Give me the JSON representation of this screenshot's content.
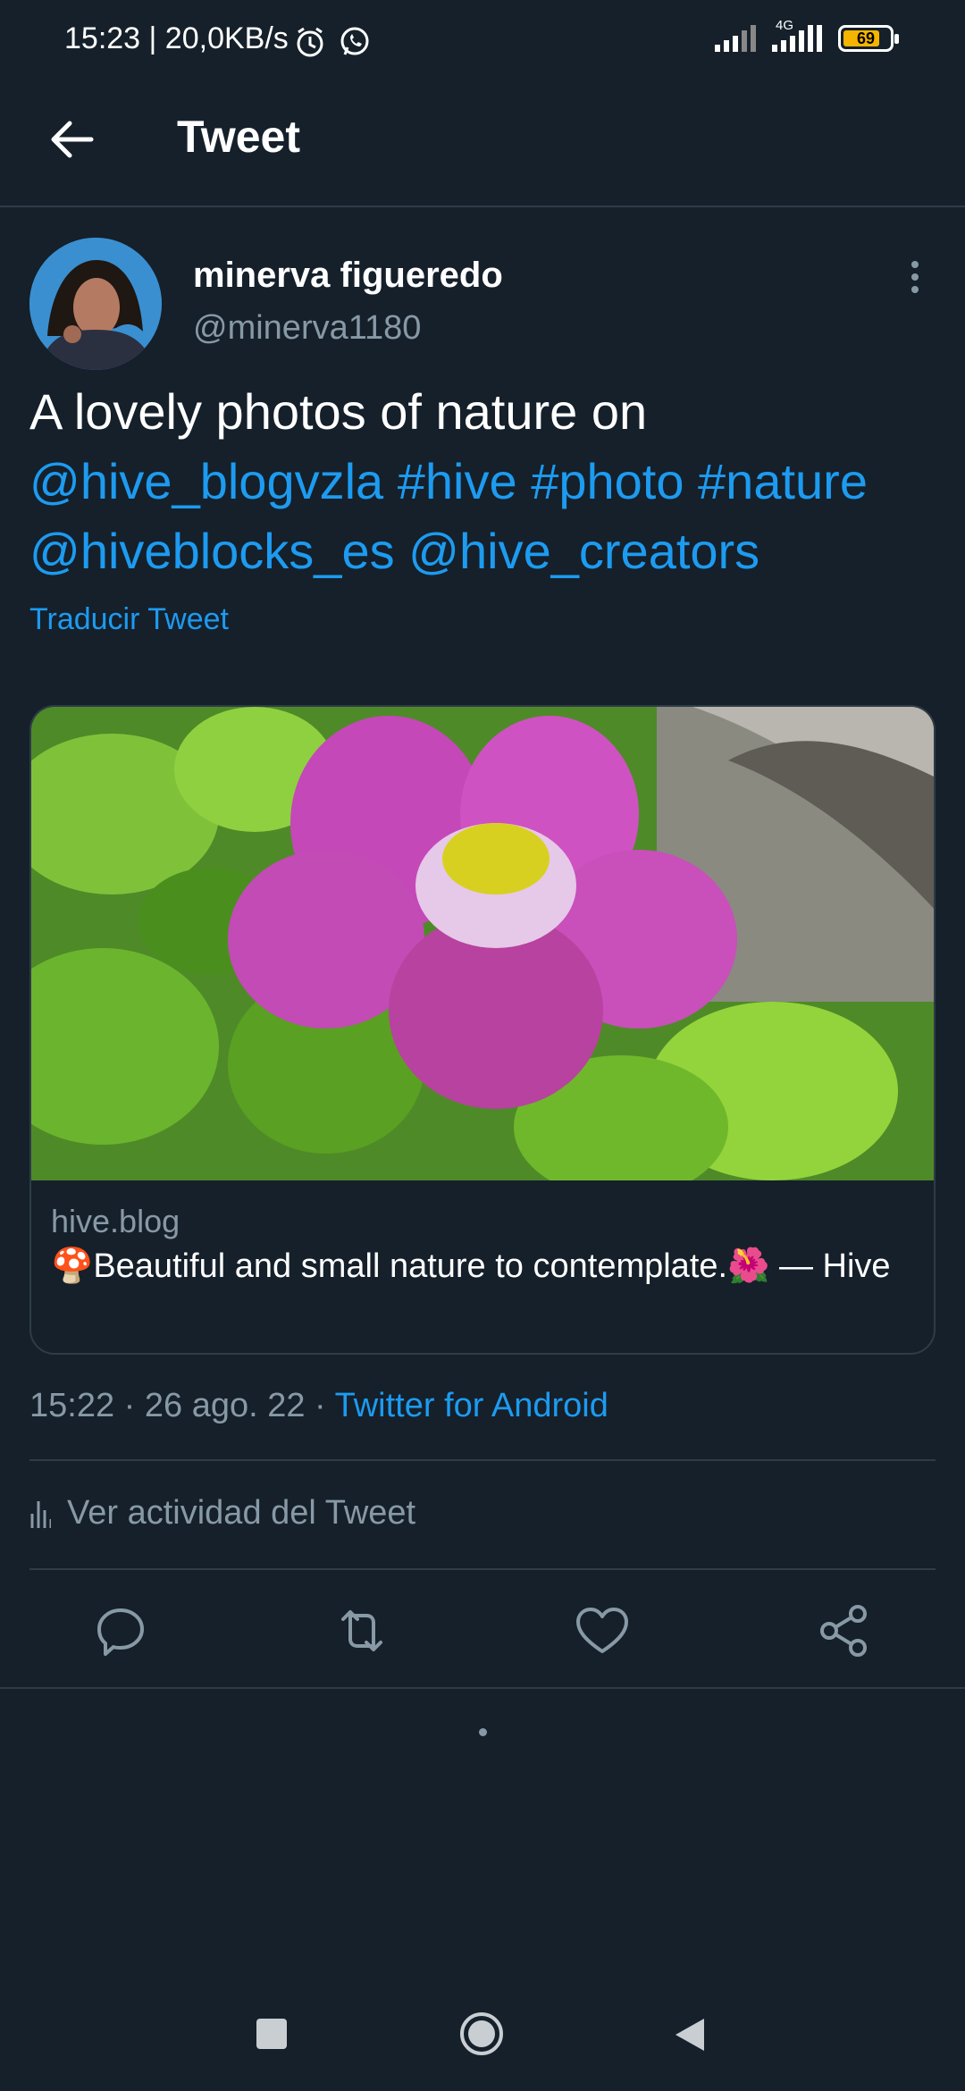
{
  "status_bar": {
    "time": "15:23 | 20,0KB/s",
    "network": "4G",
    "battery": "69",
    "icons": [
      "alarm-icon",
      "whatsapp-icon",
      "signal-icon",
      "battery-icon"
    ]
  },
  "header": {
    "title": "Tweet",
    "back_icon": "arrow-left-icon"
  },
  "tweet": {
    "author_name": "minerva figueredo",
    "author_handle": "@minerva1180",
    "text_plain": "A lovely photos of nature on",
    "mention_1": "@hive_blogvzla",
    "hashtag_1": "#hive",
    "hashtag_2": "#photo",
    "hashtag_3": "#nature",
    "mention_2": "@hiveblocks_es",
    "mention_3": "@hive_creators",
    "translate_label": "Traducir Tweet",
    "link_color": "#1d9bf0"
  },
  "card": {
    "domain": "hive.blog",
    "title": "🍄Beautiful and small nature to contemplate.🌺 — Hive"
  },
  "meta": {
    "time": "15:22",
    "date": "26 ago. 22",
    "source": "Twitter for Android"
  },
  "activity": {
    "label": "Ver actividad del Tweet"
  },
  "actions": [
    "reply-icon",
    "retweet-icon",
    "like-icon",
    "share-icon"
  ],
  "nav_bar": [
    "recents-button",
    "home-button",
    "back-button"
  ]
}
